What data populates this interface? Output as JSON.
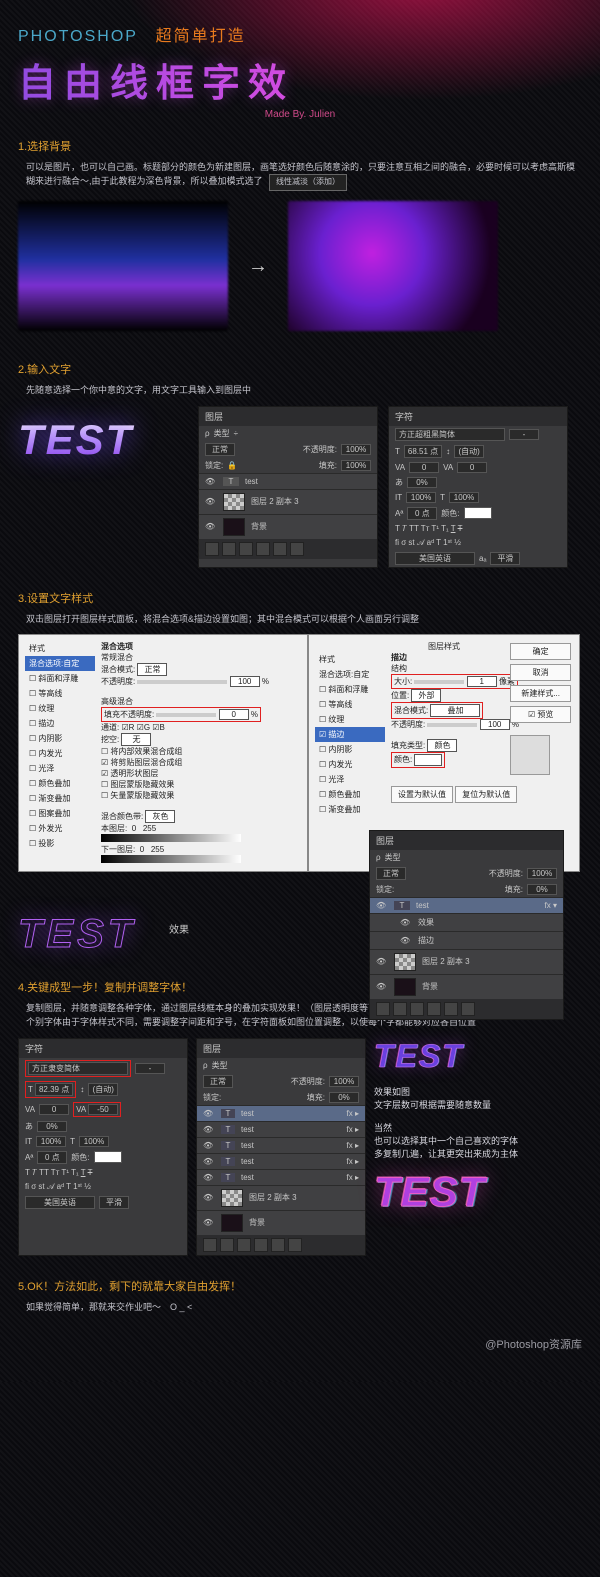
{
  "header": {
    "sub_a": "PHOTOSHOP",
    "sub_b": "超简单打造",
    "title": "自由线框字效",
    "made_by": "Made By. Julien"
  },
  "step1": {
    "title": "1.选择背景",
    "body": "可以是图片，也可以自己画。标题部分的颜色为新建图层，画笔选好颜色后随意涂的，只要注意互相之间的融合，必要时候可以考虑高斯模糊来进行融合～,由于此教程为深色背景，所以叠加模式选了",
    "mode_btn": "线性减淡（添加）"
  },
  "step2": {
    "title": "2.输入文字",
    "body": "先随意选择一个你中意的文字，用文字工具输入到图层中",
    "sample": "TEST",
    "layers_panel": {
      "title": "图层",
      "kind": "类型",
      "blend": "正常",
      "opacity_label": "不透明度:",
      "opacity_value": "100%",
      "lock_label": "锁定:",
      "fill_label": "填充:",
      "fill_value": "100%",
      "items": [
        {
          "name": "test"
        },
        {
          "name": "图层 2 副本 3"
        },
        {
          "name": "背景"
        }
      ]
    },
    "char_panel": {
      "title": "字符",
      "font": "方正超粗黑简体",
      "size": "68.51 点",
      "leading": "(自动)",
      "tracking_a": "0",
      "tracking_b": "0",
      "scale_label": "0%",
      "vscale": "100%",
      "hscale": "100%",
      "color_label": "颜色:",
      "baseline": "0 点",
      "lang": "美国英语",
      "aa": "平滑"
    }
  },
  "step3": {
    "title": "3.设置文字样式",
    "body": "双击图层打开图层样式面板，将混合选项&描边设置如图；其中混合模式可以根据个人画面另行调整",
    "dialog_title": "图层样式",
    "side_items": [
      "样式",
      "混合选项:自定",
      "斜面和浮雕",
      "等高线",
      "纹理",
      "描边",
      "内阴影",
      "内发光",
      "光泽",
      "颜色叠加",
      "渐变叠加",
      "图案叠加",
      "外发光",
      "投影"
    ],
    "blend_section": {
      "heading": "混合选项",
      "sub": "常规混合",
      "mode_label": "混合模式:",
      "mode_value": "正常",
      "opacity_label": "不透明度:",
      "opacity_value": "100",
      "adv_heading": "高级混合",
      "fill_label": "填充不透明度:",
      "fill_value": "0",
      "channels_label": "通道:",
      "ch_r": "R",
      "ch_g": "G",
      "ch_b": "B",
      "knockout_label": "挖空:",
      "knockout_value": "无",
      "opt1": "将内部效果混合成组",
      "opt2": "将剪贴图层混合成组",
      "opt3": "透明形状图层",
      "opt4": "图层蒙版隐藏效果",
      "opt5": "矢量蒙版隐藏效果",
      "blendif_label": "混合颜色带:",
      "blendif_value": "灰色",
      "this_layer": "本图层:",
      "this_a": "0",
      "this_b": "255",
      "under_layer": "下一图层:",
      "under_a": "0",
      "under_b": "255"
    },
    "stroke_section": {
      "heading": "描边",
      "structure": "结构",
      "size_label": "大小:",
      "size_value": "1",
      "size_unit": "像素",
      "pos_label": "位置:",
      "pos_value": "外部",
      "blend_label": "混合模式:",
      "blend_value": "叠加",
      "opacity_label": "不透明度:",
      "opacity_value": "100",
      "fill_type_label": "填充类型:",
      "fill_type_value": "颜色",
      "color_label": "颜色:",
      "default_btn": "设置为默认值",
      "reset_btn": "复位为默认值"
    },
    "buttons": {
      "ok": "确定",
      "cancel": "取消",
      "new_style": "新建样式...",
      "preview": "预览"
    },
    "result_label": "效果",
    "result_layers": {
      "title": "图层",
      "kind": "类型",
      "blend": "正常",
      "opacity_label": "不透明度:",
      "opacity_value": "100%",
      "lock_label": "锁定:",
      "fill_label": "填充:",
      "fill_value": "0%",
      "items": [
        {
          "name": "test",
          "fx": true
        },
        {
          "name": "效果",
          "sub": true
        },
        {
          "name": "描边",
          "sub": true
        },
        {
          "name": "图层 2 副本 3"
        },
        {
          "name": "背景"
        }
      ]
    }
  },
  "step4": {
    "title": "4.关键成型一步！复制并调整字体！",
    "body1": "复制图层，并随意调整各种字体，通过图层线框本身的叠加实现效果！（图层透明度等可以自由调整）",
    "body2": "个别字体由于字体样式不同，需要调整字间距和字号，在字符面板如图位置调整，以使每个字都能够对应各自位置",
    "char_panel": {
      "title": "字符",
      "font": "方正隶变简体",
      "size": "82.39 点",
      "leading": "(自动)",
      "tracking": "-50",
      "scale": "0%",
      "vscale": "100%",
      "hscale": "100%",
      "baseline": "0 点",
      "color_label": "颜色:",
      "lang": "美国英语",
      "aa": "平滑"
    },
    "layers_panel": {
      "title": "图层",
      "kind": "类型",
      "blend": "正常",
      "opacity_label": "不透明度:",
      "opacity_value": "100%",
      "lock_label": "锁定:",
      "fill_label": "填充:",
      "fill_value": "0%",
      "items": [
        {
          "name": "test",
          "fx": true
        },
        {
          "name": "test",
          "fx": true
        },
        {
          "name": "test",
          "fx": true
        },
        {
          "name": "test",
          "fx": true
        },
        {
          "name": "test",
          "fx": true
        },
        {
          "name": "图层 2 副本 3"
        },
        {
          "name": "背景"
        }
      ]
    },
    "note1": "效果如图",
    "note2": "文字层数可根据需要随意数量",
    "note3": "当然",
    "note4": "也可以选择其中一个自己喜欢的字体",
    "note5": "多复制几遍，让其更突出来成为主体",
    "sample": "TEST"
  },
  "step5": {
    "title": "5.OK！方法如此，剩下的就靠大家自由发挥！",
    "body": "如果觉得简单，那就来交作业吧～　O _ <"
  },
  "footer": "@Photoshop资源库"
}
